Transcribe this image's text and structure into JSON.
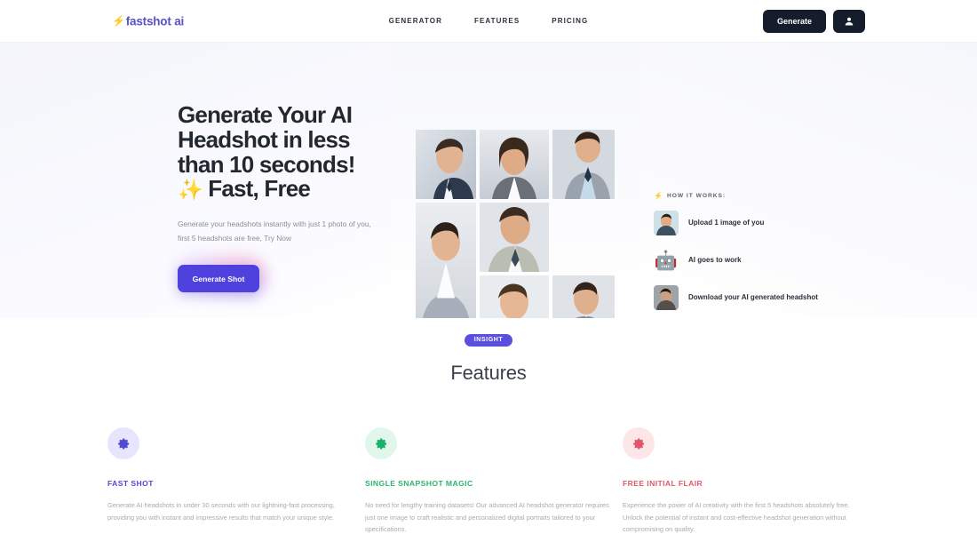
{
  "header": {
    "logo": {
      "text": "fastshot ai",
      "icon": "bolt-icon",
      "glyph": "⚡",
      "color": "#5b51c9"
    },
    "nav": [
      {
        "label": "GENERATOR",
        "name": "nav-generator"
      },
      {
        "label": "FEATURES",
        "name": "nav-features"
      },
      {
        "label": "PRICING",
        "name": "nav-pricing"
      }
    ],
    "generate_label": "Generate",
    "account_icon": "user-icon",
    "button_color": "#151c2c"
  },
  "hero": {
    "title_line1": "Generate Your AI",
    "title_line2": "Headshot in less",
    "title_line3": "than 10 seconds!",
    "title_sparkle": "✨",
    "title_line4": " Fast, Free",
    "subtitle": "Generate your headshots instantly with just 1 photo of you, first 5 headshots are free, Try Now",
    "cta_label": "Generate Shot",
    "cta_color": "#4f41dd",
    "gallery_count": 7,
    "gallery_alt": "AI generated male headshot"
  },
  "how_it_works": {
    "heading": "HOW IT WORKS:",
    "heading_icon": "bolt-icon",
    "heading_glyph": "⚡",
    "steps": [
      {
        "label": "Upload 1 image of you",
        "icon": "photo-thumbnail",
        "name": "step-upload"
      },
      {
        "label": "AI goes to work",
        "icon": "robot-icon",
        "glyph": "🤖",
        "name": "step-ai"
      },
      {
        "label": "Download your AI generated headshot",
        "icon": "photo-thumbnail",
        "name": "step-download"
      }
    ]
  },
  "features": {
    "badge": "INSIGHT",
    "title": "Features",
    "cards": [
      {
        "title": "FAST SHOT",
        "body": "Generate AI headshots in under 30 seconds with our lightning-fast processing, providing you with instant and impressive results that match your unique style.",
        "icon": "gear-icon",
        "color": "#5248d6",
        "bg": "#e6e5fb"
      },
      {
        "title": "SINGLE SNAPSHOT MAGIC",
        "body": "No need for lengthy training datasets! Our advanced AI headshot generator requires just one image to craft realistic and personalized digital portraits tailored to your specifications.",
        "icon": "gear-icon",
        "color": "#2bb673",
        "bg": "#e2f7ec"
      },
      {
        "title": "FREE INITIAL FLAIR",
        "body": "Experience the power of AI creativity with the first 5 headshots absolutely free. Unlock the potential of instant and cost-effective headshot generation without compromising on quality.",
        "icon": "gear-icon",
        "color": "#e2566a",
        "bg": "#fde6e8"
      }
    ]
  }
}
